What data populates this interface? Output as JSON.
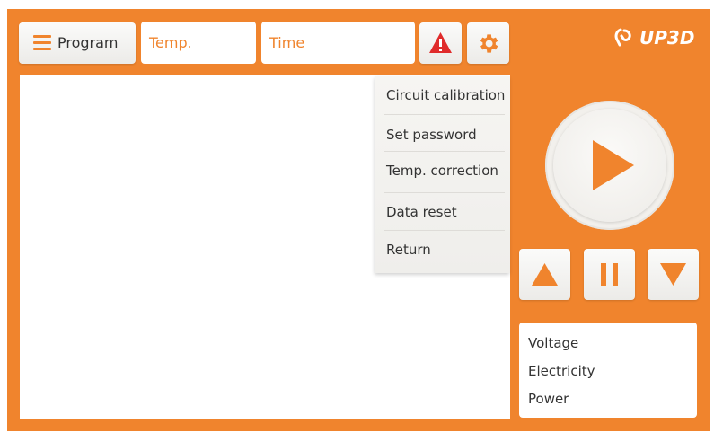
{
  "header": {
    "program_label": "Program",
    "temp_placeholder": "Temp.",
    "time_placeholder": "Time",
    "logo_text": "UP3D"
  },
  "menu": {
    "items": [
      {
        "label": "Circuit calibration"
      },
      {
        "label": "Set password"
      },
      {
        "label": "Temp. correction"
      },
      {
        "label": "Data reset"
      },
      {
        "label": "Return"
      }
    ]
  },
  "info": {
    "lines": [
      {
        "label": "Voltage"
      },
      {
        "label": "Electricity"
      },
      {
        "label": "Power"
      }
    ]
  },
  "colors": {
    "accent": "#f0842d",
    "alert": "#e02b2b",
    "panel": "#ffffff"
  },
  "icons": {
    "menu": "hamburger-icon",
    "alert": "warning-icon",
    "settings": "gear-icon",
    "play": "play-icon",
    "up": "arrow-up-icon",
    "pause": "pause-icon",
    "down": "arrow-down-icon"
  }
}
